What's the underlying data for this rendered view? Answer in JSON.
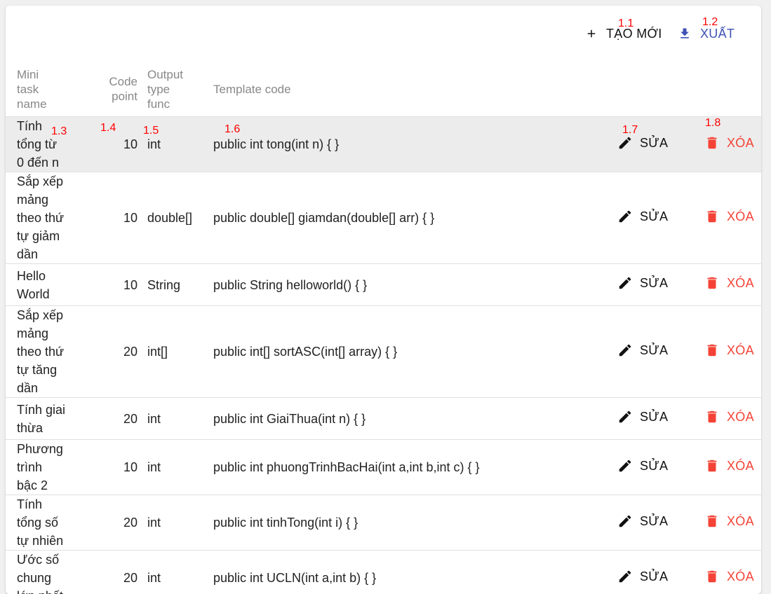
{
  "toolbar": {
    "create_label": "TẠO MỚI",
    "export_label": "XUẤT",
    "create_icon": "plus-icon",
    "export_icon": "download-icon"
  },
  "annotations": [
    "1.1",
    "1.2",
    "1.3",
    "1.4",
    "1.5",
    "1.6",
    "1.7",
    "1.8"
  ],
  "table": {
    "headers": {
      "name": "Mini task name",
      "point": "Code point",
      "type": "Output type func",
      "template": "Template code"
    },
    "edit_label": "SỬA",
    "delete_label": "XÓA",
    "rows": [
      {
        "name": "Tính tổng từ 0 đến n",
        "point": "10",
        "type": "int",
        "template": "public int tong(int n) { }"
      },
      {
        "name": "Sắp xếp mảng theo thứ tự giảm dần",
        "point": "10",
        "type": "double[]",
        "template": "public double[] giamdan(double[] arr) { }"
      },
      {
        "name": "Hello World",
        "point": "10",
        "type": "String",
        "template": "public String helloworld() { }"
      },
      {
        "name": "Sắp xếp mảng theo thứ tự tăng dần",
        "point": "20",
        "type": "int[]",
        "template": "public int[] sortASC(int[] array) { }"
      },
      {
        "name": "Tính giai thừa",
        "point": "20",
        "type": "int",
        "template": "public int GiaiThua(int n) { }"
      },
      {
        "name": "Phương trình bậc 2",
        "point": "10",
        "type": "int",
        "template": "public int phuongTrinhBacHai(int a,int b,int c) { }"
      },
      {
        "name": "Tính tổng số tự nhiên",
        "point": "20",
        "type": "int",
        "template": "public int tinhTong(int i) { }"
      },
      {
        "name": "Ước số chung lớn nhất",
        "point": "20",
        "type": "int",
        "template": "public int UCLN(int a,int b) { }"
      }
    ]
  },
  "colors": {
    "accent": "#3f51b5",
    "danger": "#f44336",
    "annotation": "#ff0000",
    "row_highlight": "#ececec"
  }
}
